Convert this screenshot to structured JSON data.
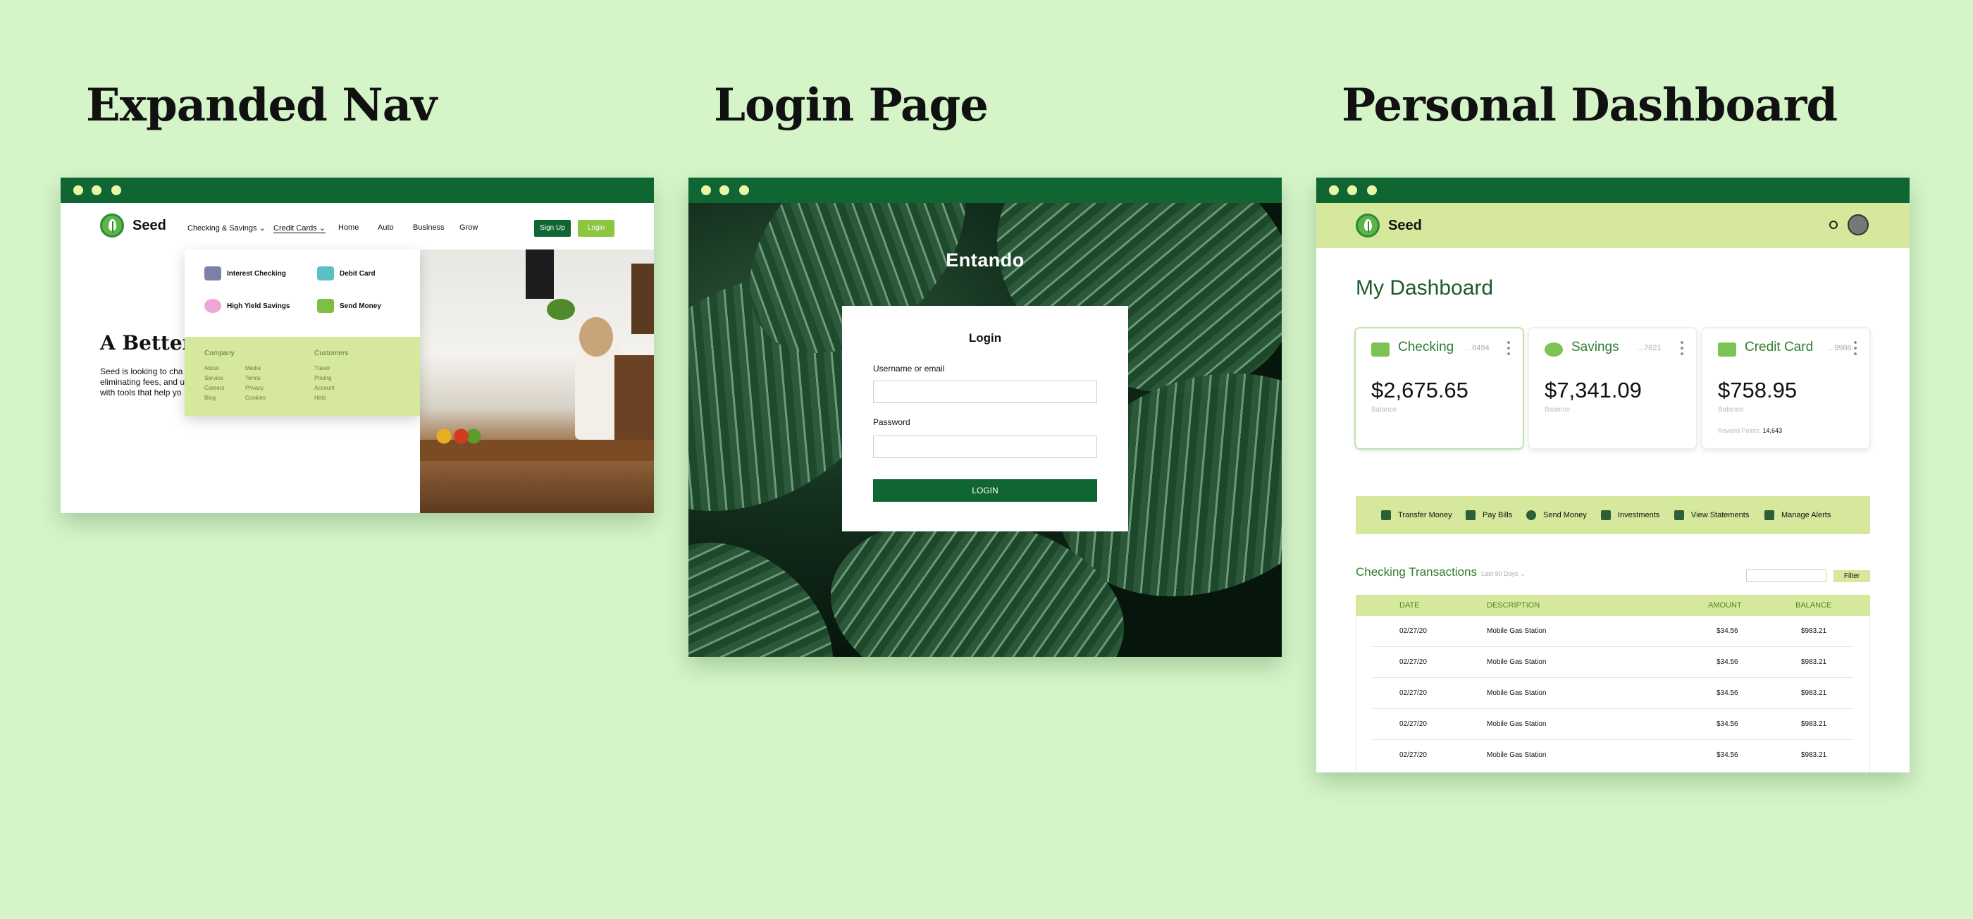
{
  "titles": {
    "expanded_nav": "Expanded Nav",
    "login_page": "Login Page",
    "personal_dashboard": "Personal Dashboard"
  },
  "nav_window": {
    "brand": "Seed",
    "menu": [
      "Checking & Savings ⌄",
      "Credit Cards ⌄",
      "Home",
      "Auto",
      "Business",
      "Grow"
    ],
    "signup": "Sign Up",
    "login": "Login",
    "hero_heading": "A Better",
    "hero_lines": [
      "Seed is looking to cha",
      "eliminating fees, and u",
      "with tools that help yo"
    ],
    "dropdown": {
      "items": [
        "Interest Checking",
        "Debit Card",
        "High Yield Savings",
        "Send Money"
      ],
      "company_head": "Company",
      "company_links": [
        "About",
        "Service",
        "Careers",
        "Blog"
      ],
      "company_links2": [
        "Media",
        "Terms",
        "Privacy",
        "Cookies"
      ],
      "customers_head": "Customers",
      "customer_links": [
        "Travel",
        "Pricing",
        "Account",
        "Help"
      ]
    }
  },
  "login_window": {
    "brand": "Entando",
    "card_title": "Login",
    "username_label": "Username or email",
    "password_label": "Password",
    "submit": "LOGIN"
  },
  "dashboard_window": {
    "brand": "Seed",
    "heading": "My Dashboard",
    "accounts": [
      {
        "name": "Checking",
        "number": "...8494",
        "amount": "$2,675.65",
        "label": "Balance"
      },
      {
        "name": "Savings",
        "number": "...7621",
        "amount": "$7,341.09",
        "label": "Balance"
      },
      {
        "name": "Credit Card",
        "number": "...9986",
        "amount": "$758.95",
        "label": "Balance",
        "reward_label": "Reward Points:",
        "reward_value": "14,643"
      }
    ],
    "quick_actions": [
      "Transfer Money",
      "Pay Bills",
      "Send Money",
      "Investments",
      "View Statements",
      "Manage Alerts"
    ],
    "transactions_title": "Checking Transactions",
    "range": "Last 90 Days ⌄",
    "filter": "Filter",
    "columns": [
      "DATE",
      "DESCRIPTION",
      "AMOUNT",
      "BALANCE"
    ],
    "rows": [
      [
        "02/27/20",
        "Mobile Gas Station",
        "$34.56",
        "$983.21"
      ],
      [
        "02/27/20",
        "Mobile Gas Station",
        "$34.56",
        "$983.21"
      ],
      [
        "02/27/20",
        "Mobile Gas Station",
        "$34.56",
        "$983.21"
      ],
      [
        "02/27/20",
        "Mobile Gas Station",
        "$34.56",
        "$983.21"
      ],
      [
        "02/27/20",
        "Mobile Gas Station",
        "$34.56",
        "$983.21"
      ]
    ]
  }
}
